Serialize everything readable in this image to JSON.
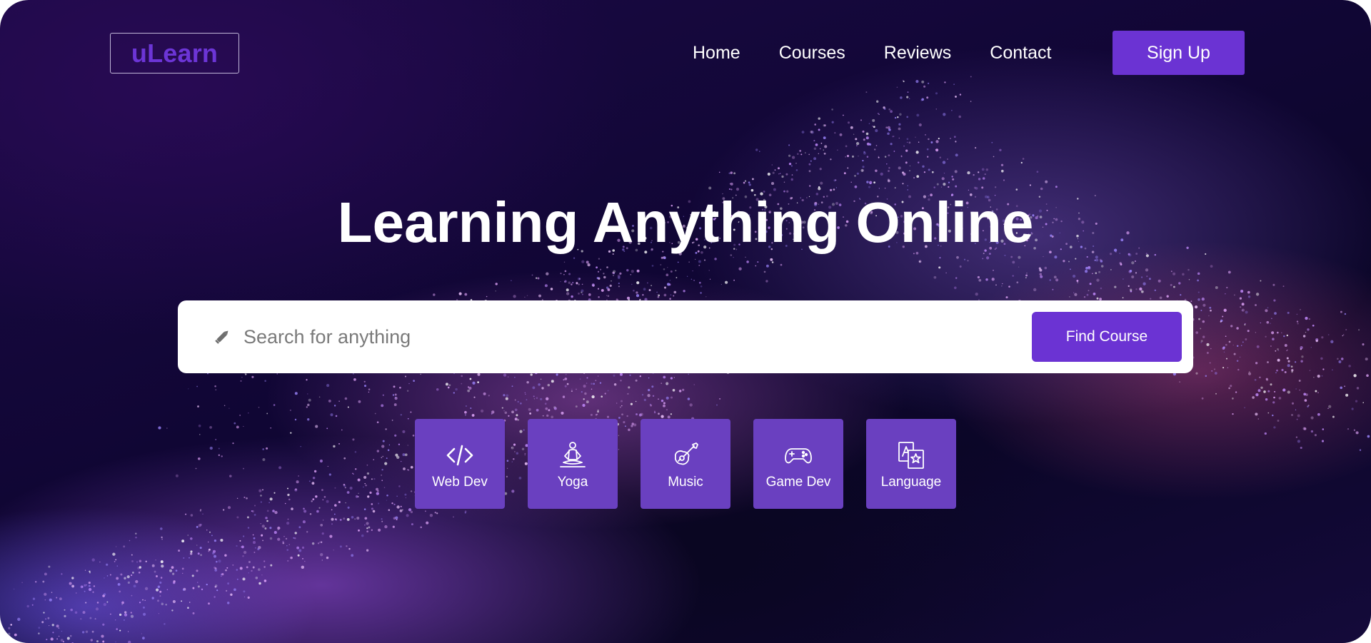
{
  "brand": {
    "logo": "uLearn"
  },
  "nav": {
    "links": [
      "Home",
      "Courses",
      "Reviews",
      "Contact"
    ],
    "signup_label": "Sign Up"
  },
  "hero": {
    "title": "Learning Anything Online"
  },
  "search": {
    "icon": "pencil-icon",
    "placeholder": "Search for anything",
    "value": "",
    "button_label": "Find Course"
  },
  "categories": [
    {
      "label": "Web Dev",
      "icon": "code-icon"
    },
    {
      "label": "Yoga",
      "icon": "yoga-icon"
    },
    {
      "label": "Music",
      "icon": "guitar-icon"
    },
    {
      "label": "Game Dev",
      "icon": "gamepad-icon"
    },
    {
      "label": "Language",
      "icon": "translate-icon"
    }
  ],
  "colors": {
    "accent": "#6b33d3",
    "category_tile": "#6a40c0",
    "logo_text": "#6c35d6"
  }
}
